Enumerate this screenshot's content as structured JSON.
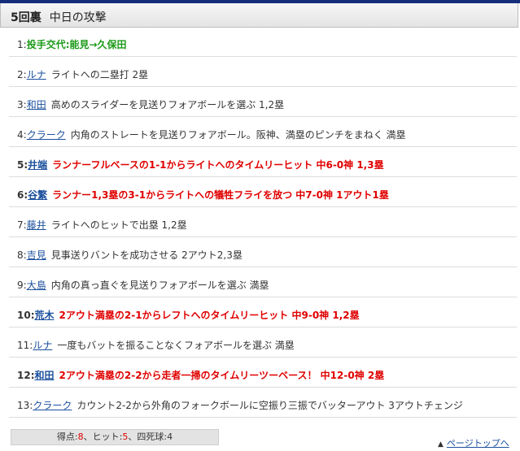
{
  "header": {
    "inning": "5回裏",
    "team_attack": "中日の攻撃"
  },
  "plays": [
    {
      "num": "1:",
      "player": "",
      "text": "投手交代:能見→久保田",
      "style": "green"
    },
    {
      "num": "2:",
      "player": "ルナ",
      "text": "ライトへの二塁打 2塁",
      "style": "normal"
    },
    {
      "num": "3:",
      "player": "和田",
      "text": "高めのスライダーを見送りフォアボールを選ぶ 1,2塁",
      "style": "normal"
    },
    {
      "num": "4:",
      "player": "クラーク",
      "text": "内角のストレートを見送りフォアボール。阪神、満塁のピンチをまねく 満塁",
      "style": "normal"
    },
    {
      "num": "5:",
      "player": "井端",
      "text": "ランナーフルベースの1-1からライトへのタイムリーヒット 中6-0神 1,3塁",
      "style": "highlight"
    },
    {
      "num": "6:",
      "player": "谷繁",
      "text": "ランナー1,3塁の3-1からライトへの犠牲フライを放つ 中7-0神 1アウト1塁",
      "style": "highlight"
    },
    {
      "num": "7:",
      "player": "藤井",
      "text": "ライトへのヒットで出塁 1,2塁",
      "style": "normal"
    },
    {
      "num": "8:",
      "player": "吉見",
      "text": "見事送りバントを成功させる 2アウト2,3塁",
      "style": "normal"
    },
    {
      "num": "9:",
      "player": "大島",
      "text": "内角の真っ直ぐを見送りフォアボールを選ぶ 満塁",
      "style": "normal"
    },
    {
      "num": "10:",
      "player": "荒木",
      "text": "2アウト満塁の2-1からレフトへのタイムリーヒット 中9-0神 1,2塁",
      "style": "highlight"
    },
    {
      "num": "11:",
      "player": "ルナ",
      "text": "一度もバットを振ることなくフォアボールを選ぶ 満塁",
      "style": "normal"
    },
    {
      "num": "12:",
      "player": "和田",
      "text": "2アウト満塁の2-2から走者一掃のタイムリーツーベース！ 中12-0神 2塁",
      "style": "highlight"
    },
    {
      "num": "13:",
      "player": "クラーク",
      "text": "カウント2-2から外角のフォークボールに空振り三振でバッターアウト 3アウトチェンジ",
      "style": "normal"
    }
  ],
  "summary": {
    "runs_label": "得点:",
    "runs": "8",
    "hits_label": "、ヒット:",
    "hits": "5",
    "walks_label": "、四死球:",
    "walks": "4"
  },
  "pagetop": {
    "arrow": "▲",
    "label": "ページトップへ"
  },
  "colors": {
    "accent_bar": "#152e7a",
    "link": "#1a4f9c",
    "highlight": "#e00000",
    "change": "#1c9a18"
  }
}
